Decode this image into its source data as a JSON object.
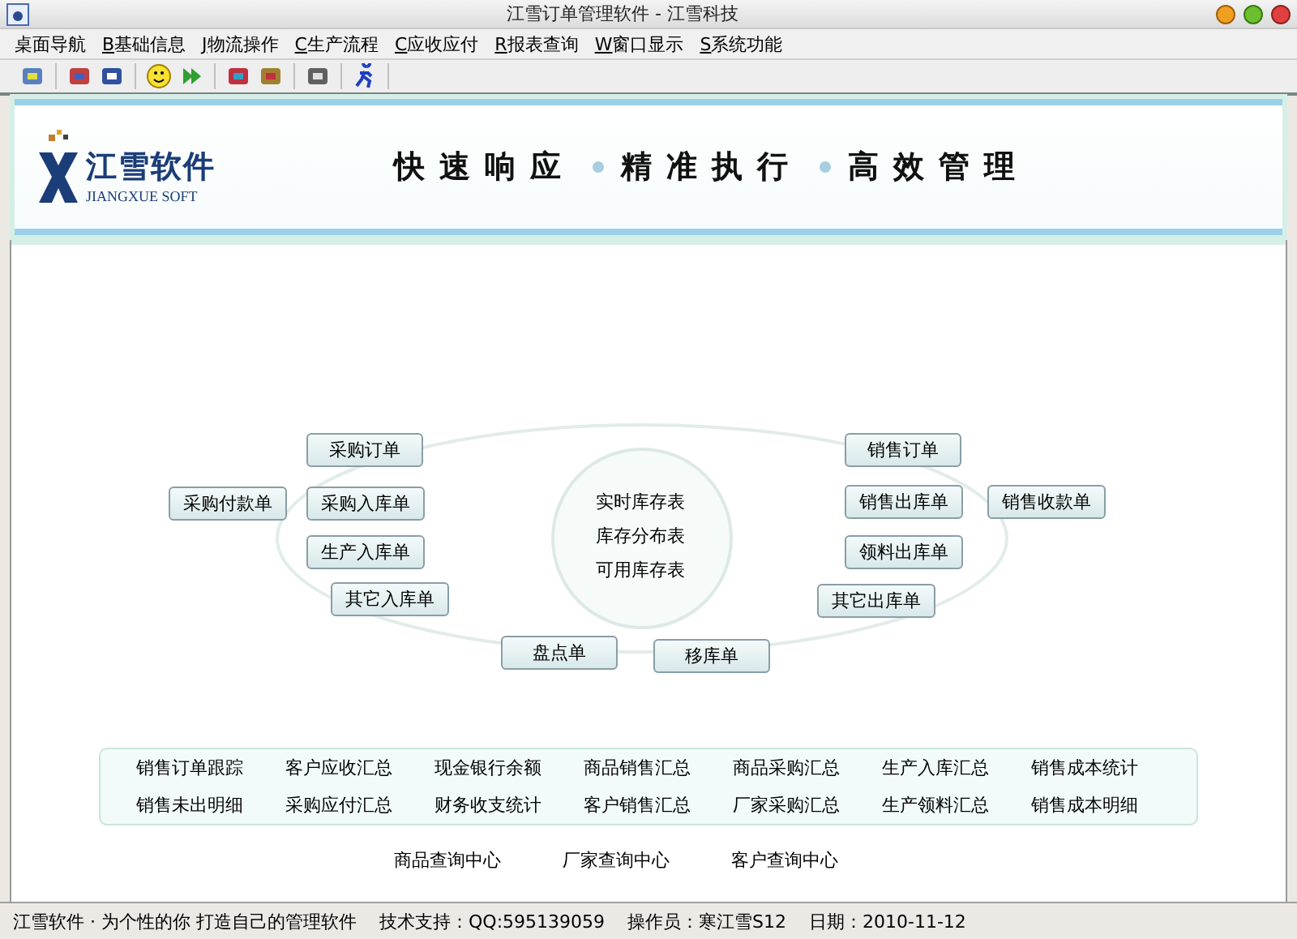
{
  "window": {
    "title": "江雪订单管理软件 - 江雪科技"
  },
  "menu": [
    {
      "label": "桌面导航"
    },
    {
      "key": "B",
      "label": "基础信息"
    },
    {
      "key": "J",
      "label": "物流操作"
    },
    {
      "key": "C",
      "label": "生产流程"
    },
    {
      "key": "C",
      "label": "应收应付"
    },
    {
      "key": "R",
      "label": "报表查询"
    },
    {
      "key": "W",
      "label": "窗口显示"
    },
    {
      "key": "S",
      "label": "系统功能"
    }
  ],
  "banner": {
    "logo_name": "江雪软件",
    "logo_subtitle": "JIANGXUE SOFT",
    "slogans": [
      "快速响应",
      "精准执行",
      "高效管理"
    ]
  },
  "flow": {
    "center_reports": [
      "实时库存表",
      "库存分布表",
      "可用库存表"
    ],
    "nodes": [
      "采购订单",
      "采购付款单",
      "采购入库单",
      "生产入库单",
      "其它入库单",
      "盘点单",
      "移库单",
      "销售订单",
      "销售出库单",
      "销售收款单",
      "领料出库单",
      "其它出库单"
    ]
  },
  "reports": {
    "rows": [
      [
        "销售订单跟踪",
        "客户应收汇总",
        "现金银行余额",
        "商品销售汇总",
        "商品采购汇总",
        "生产入库汇总",
        "销售成本统计"
      ],
      [
        "销售未出明细",
        "采购应付汇总",
        "财务收支统计",
        "客户销售汇总",
        "厂家采购汇总",
        "生产领料汇总",
        "销售成本明细"
      ]
    ]
  },
  "query_centers": [
    "商品查询中心",
    "厂家查询中心",
    "客户查询中心"
  ],
  "status_bar": [
    "江雪软件 · 为个性的你 打造自己的管理软件",
    "技术支持：QQ:595139059",
    "操作员：寒江雪S12",
    "日期：2010-11-12"
  ]
}
